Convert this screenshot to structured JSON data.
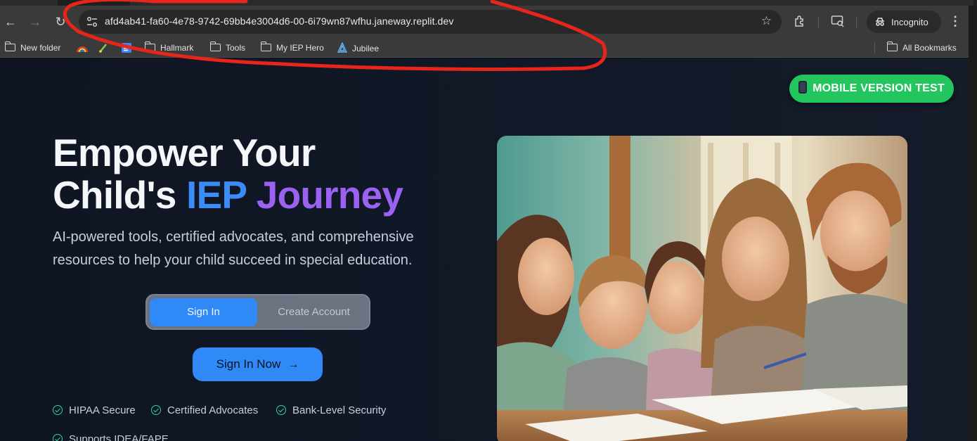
{
  "browser": {
    "url": "afd4ab41-fa60-4e78-9742-69bb4e3004d6-00-6i79wn87wfhu.janeway.replit.dev",
    "profile_label": "Incognito",
    "bookmarks": [
      {
        "label": "New folder",
        "icon": "folder-icon"
      },
      {
        "label": "",
        "icon": "rainbow-favicon"
      },
      {
        "label": "",
        "icon": "green-favicon"
      },
      {
        "label": "",
        "icon": "docs-favicon"
      },
      {
        "label": "Hallmark",
        "icon": "folder-icon"
      },
      {
        "label": "Tools",
        "icon": "folder-icon"
      },
      {
        "label": "My IEP Hero",
        "icon": "folder-icon"
      },
      {
        "label": "Jubilee",
        "icon": "jubilee-favicon"
      }
    ],
    "all_bookmarks_label": "All Bookmarks"
  },
  "page": {
    "mobile_button": "MOBILE VERSION TEST",
    "title_line1": "Empower Your",
    "title_line2_prefix": "Child's ",
    "title_iep": "IEP",
    "title_journey": " Journey",
    "subtitle": "AI-powered tools, certified advocates, and comprehensive resources to help your child succeed in special education.",
    "toggle": {
      "active": "Sign In",
      "inactive": "Create Account"
    },
    "cta": "Sign In Now",
    "features": [
      "HIPAA Secure",
      "Certified Advocates",
      "Bank-Level Security",
      "Supports IDEA/FAPE"
    ],
    "colors": {
      "accent_blue": "#3b8cf6",
      "accent_purple": "#9b62f2",
      "cta_green": "#22c55e",
      "check_green": "#34d399"
    }
  }
}
